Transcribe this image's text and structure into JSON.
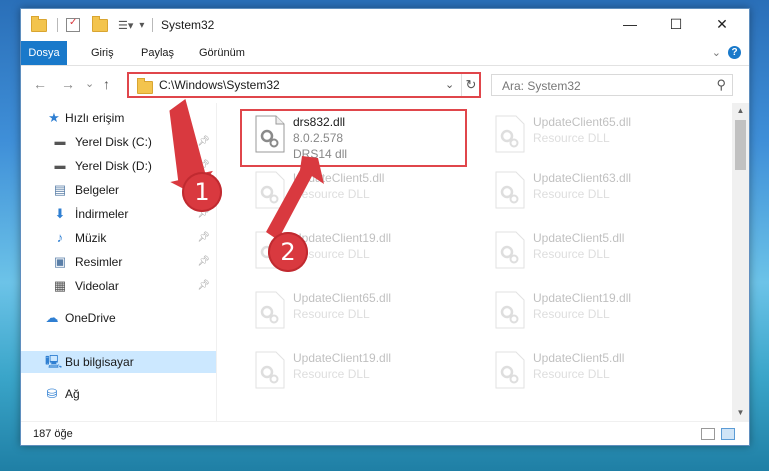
{
  "window": {
    "title": "System32",
    "controls": {
      "minimize": "—",
      "maximize": "☐",
      "close": "✕"
    }
  },
  "ribbon": {
    "tabs": [
      {
        "label": "Dosya"
      },
      {
        "label": "Giriş"
      },
      {
        "label": "Paylaş"
      },
      {
        "label": "Görünüm"
      }
    ],
    "help": "?",
    "expand": "⌄"
  },
  "nav": {
    "back": "←",
    "forward": "→",
    "recent": "⌄",
    "up": "↑",
    "address": "C:\\Windows\\System32",
    "address_dropdown": "⌄",
    "refresh": "↻",
    "search_placeholder": "Ara: System32"
  },
  "sidebar": {
    "items": [
      {
        "label": "Hızlı erişim",
        "icon": "star-icon"
      },
      {
        "label": "Yerel Disk (C:)",
        "icon": "drive-icon",
        "pinned": true
      },
      {
        "label": "Yerel Disk (D:)",
        "icon": "drive-icon",
        "pinned": true
      },
      {
        "label": "Belgeler",
        "icon": "documents-icon",
        "pinned": true
      },
      {
        "label": "İndirmeler",
        "icon": "download-icon",
        "pinned": true
      },
      {
        "label": "Müzik",
        "icon": "music-icon",
        "pinned": true
      },
      {
        "label": "Resimler",
        "icon": "pictures-icon",
        "pinned": true
      },
      {
        "label": "Videolar",
        "icon": "videos-icon",
        "pinned": true
      },
      {
        "label": "OneDrive",
        "icon": "cloud-icon"
      },
      {
        "label": "Bu bilgisayar",
        "icon": "computer-icon",
        "selected": true
      },
      {
        "label": "Ağ",
        "icon": "network-icon"
      }
    ]
  },
  "files": {
    "highlighted": {
      "name": "drs832.dll",
      "version": "8.0.2.578",
      "type": "DRS14 dll"
    },
    "left_column": [
      {
        "name": "UpdateClient5.dll",
        "type": "Resource DLL"
      },
      {
        "name": "UpdateClient19.dll",
        "type": "Resource DLL"
      },
      {
        "name": "UpdateClient65.dll",
        "type": "Resource DLL"
      },
      {
        "name": "UpdateClient19.dll",
        "type": "Resource DLL"
      }
    ],
    "right_column": [
      {
        "name": "UpdateClient65.dll",
        "type": "Resource DLL"
      },
      {
        "name": "UpdateClient63.dll",
        "type": "Resource DLL"
      },
      {
        "name": "UpdateClient5.dll",
        "type": "Resource DLL"
      },
      {
        "name": "UpdateClient19.dll",
        "type": "Resource DLL"
      },
      {
        "name": "UpdateClient5.dll",
        "type": "Resource DLL"
      }
    ]
  },
  "status": {
    "count": "187 öğe"
  },
  "annotations": {
    "step1": "1",
    "step2": "2",
    "color": "#d9393f"
  },
  "colors": {
    "accent": "#1979ca",
    "highlight_border": "#e0464b",
    "selected_bg": "#cce8ff"
  }
}
